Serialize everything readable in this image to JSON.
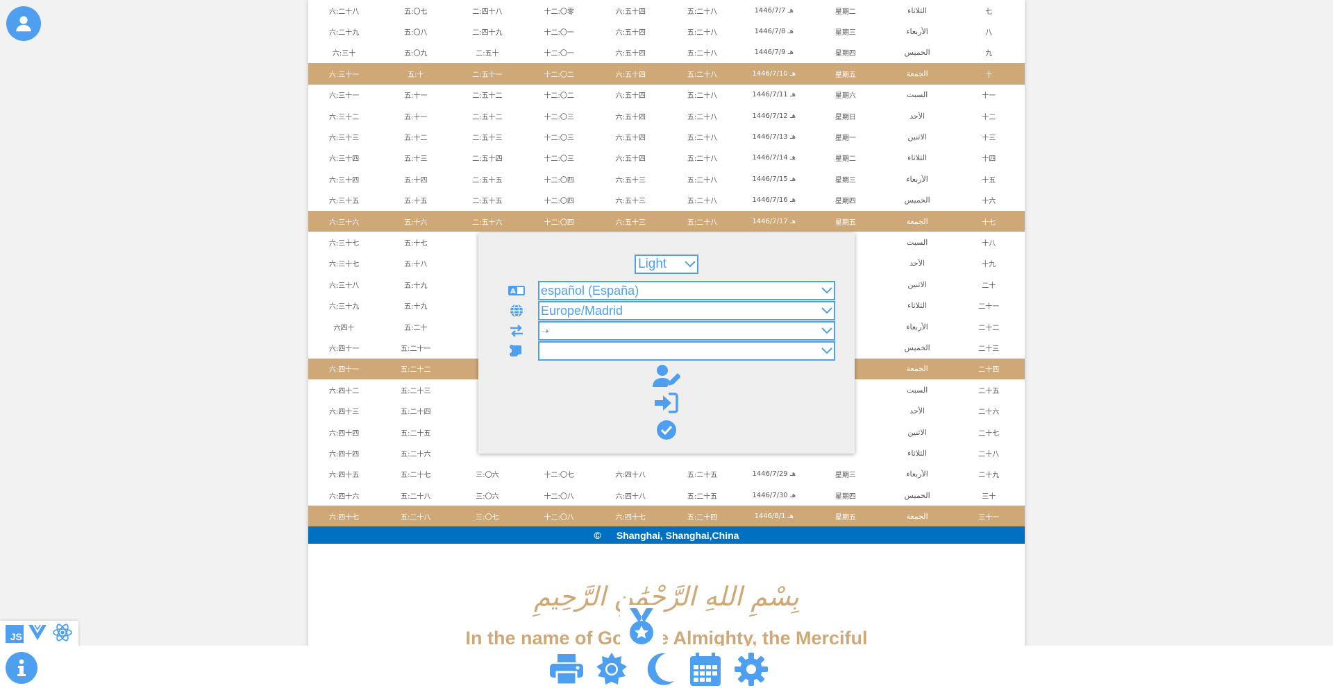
{
  "table": {
    "rows": [
      {
        "c": [
          "六:二十八",
          "五:〇七",
          "二:四十八",
          "十二:〇零",
          "六:五十四",
          "五:二十八",
          "1446/7/7 هـ",
          "星期二",
          "الثلاثاء",
          "七"
        ],
        "hl": false
      },
      {
        "c": [
          "六:二十九",
          "五:〇八",
          "二:四十九",
          "十二:〇一",
          "六:五十四",
          "五:二十八",
          "1446/7/8 هـ",
          "星期三",
          "الأربعاء",
          "八"
        ],
        "hl": false
      },
      {
        "c": [
          "六:三十",
          "五:〇九",
          "二:五十",
          "十二:〇一",
          "六:五十四",
          "五:二十八",
          "1446/7/9 هـ",
          "星期四",
          "الخميس",
          "九"
        ],
        "hl": false
      },
      {
        "c": [
          "六:三十一",
          "五:十",
          "二:五十一",
          "十二:〇二",
          "六:五十四",
          "五:二十八",
          "1446/7/10 هـ",
          "星期五",
          "الجمعة",
          "十"
        ],
        "hl": true
      },
      {
        "c": [
          "六:三十一",
          "五:十一",
          "二:五十二",
          "十二:〇二",
          "六:五十四",
          "五:二十八",
          "1446/7/11 هـ",
          "星期六",
          "السبت",
          "十一"
        ],
        "hl": false
      },
      {
        "c": [
          "六:三十二",
          "五:十一",
          "二:五十二",
          "十二:〇三",
          "六:五十四",
          "五:二十八",
          "1446/7/12 هـ",
          "星期日",
          "الأحد",
          "十二"
        ],
        "hl": false
      },
      {
        "c": [
          "六:三十三",
          "五:十二",
          "二:五十三",
          "十二:〇三",
          "六:五十四",
          "五:二十八",
          "1446/7/13 هـ",
          "星期一",
          "الاثنين",
          "十三"
        ],
        "hl": false
      },
      {
        "c": [
          "六:三十四",
          "五:十三",
          "二:五十四",
          "十二:〇三",
          "六:五十四",
          "五:二十八",
          "1446/7/14 هـ",
          "星期二",
          "الثلاثاء",
          "十四"
        ],
        "hl": false
      },
      {
        "c": [
          "六:三十四",
          "五:十四",
          "二:五十五",
          "十二:〇四",
          "六:五十三",
          "五:二十八",
          "1446/7/15 هـ",
          "星期三",
          "الأربعاء",
          "十五"
        ],
        "hl": false
      },
      {
        "c": [
          "六:三十五",
          "五:十五",
          "二:五十五",
          "十二:〇四",
          "六:五十三",
          "五:二十八",
          "1446/7/16 هـ",
          "星期四",
          "الخميس",
          "十六"
        ],
        "hl": false
      },
      {
        "c": [
          "六:三十六",
          "五:十六",
          "二:五十六",
          "十二:〇四",
          "六:五十三",
          "五:二十八",
          "1446/7/17 هـ",
          "星期五",
          "الجمعة",
          "十七"
        ],
        "hl": true
      },
      {
        "c": [
          "六:三十七",
          "五:十七",
          "",
          "",
          "",
          "",
          "",
          "",
          "السبت",
          "十八"
        ],
        "hl": false
      },
      {
        "c": [
          "六:三十七",
          "五:十八",
          "",
          "",
          "",
          "",
          "",
          "",
          "الأحد",
          "十九"
        ],
        "hl": false
      },
      {
        "c": [
          "六:三十八",
          "五:十九",
          "",
          "",
          "",
          "",
          "",
          "",
          "الاثنين",
          "二十"
        ],
        "hl": false
      },
      {
        "c": [
          "六:三十九",
          "五:十九",
          "",
          "",
          "",
          "",
          "",
          "",
          "الثلاثاء",
          "二十一"
        ],
        "hl": false
      },
      {
        "c": [
          "六四十",
          "五:二十",
          "",
          "",
          "",
          "",
          "",
          "",
          "الأربعاء",
          "二十二"
        ],
        "hl": false
      },
      {
        "c": [
          "六:四十一",
          "五:二十一",
          "",
          "",
          "",
          "",
          "",
          "",
          "الخميس",
          "二十三"
        ],
        "hl": false
      },
      {
        "c": [
          "六:四十一",
          "五:二十二",
          "",
          "",
          "",
          "",
          "",
          "",
          "الجمعة",
          "二十四"
        ],
        "hl": true
      },
      {
        "c": [
          "六:四十二",
          "五:二十三",
          "",
          "",
          "",
          "",
          "",
          "",
          "السبت",
          "二十五"
        ],
        "hl": false
      },
      {
        "c": [
          "六:四十三",
          "五:二十四",
          "",
          "",
          "",
          "",
          "",
          "",
          "الأحد",
          "二十六"
        ],
        "hl": false
      },
      {
        "c": [
          "六:四十四",
          "五:二十五",
          "",
          "",
          "",
          "",
          "",
          "",
          "الاثنين",
          "二十七"
        ],
        "hl": false
      },
      {
        "c": [
          "六:四十四",
          "五:二十六",
          "",
          "",
          "",
          "",
          "",
          "",
          "الثلاثاء",
          "二十八"
        ],
        "hl": false
      },
      {
        "c": [
          "六:四十五",
          "五:二十七",
          "三:〇六",
          "十二:〇七",
          "六:四十八",
          "五:二十五",
          "1446/7/29 هـ",
          "星期三",
          "الأربعاء",
          "二十九"
        ],
        "hl": false
      },
      {
        "c": [
          "六:四十六",
          "五:二十八",
          "三:〇六",
          "十二:〇八",
          "六:四十八",
          "五:二十五",
          "1446/7/30 هـ",
          "星期四",
          "الخميس",
          "三十"
        ],
        "hl": false
      },
      {
        "c": [
          "六:四十七",
          "五:二十八",
          "三:〇七",
          "十二:〇八",
          "六:四十七",
          "五:二十四",
          "1446/8/1 هـ",
          "星期五",
          "الجمعة",
          "三十一"
        ],
        "hl": true
      }
    ]
  },
  "footer": {
    "copyright": "©",
    "location": "Shanghai, Shanghai,China"
  },
  "header": {
    "basmala": "بِسْمِ اللهِ الرَّحْمَٰنِ الرَّحِيمِ",
    "motto": "In the name of God the Almighty, the Merciful"
  },
  "settings": {
    "theme": "Light",
    "language": "español (España)",
    "timezone": "Europe/Madrid",
    "direction": "➝",
    "calculation": ""
  },
  "colors": {
    "accent": "#4f9ff0",
    "highlight_row": "#cfa878",
    "footer_bar": "#0070c0"
  },
  "icons": [
    "user-icon",
    "translate-icon",
    "globe-icon",
    "swap-icon",
    "scroll-icon",
    "user-edit-icon",
    "sign-in-icon",
    "check-circle-icon",
    "js-icon",
    "vue-icon",
    "react-icon",
    "info-icon",
    "print-icon",
    "sun-gear-icon",
    "moon-icon",
    "calendar-icon",
    "gear-icon",
    "medal-icon"
  ]
}
